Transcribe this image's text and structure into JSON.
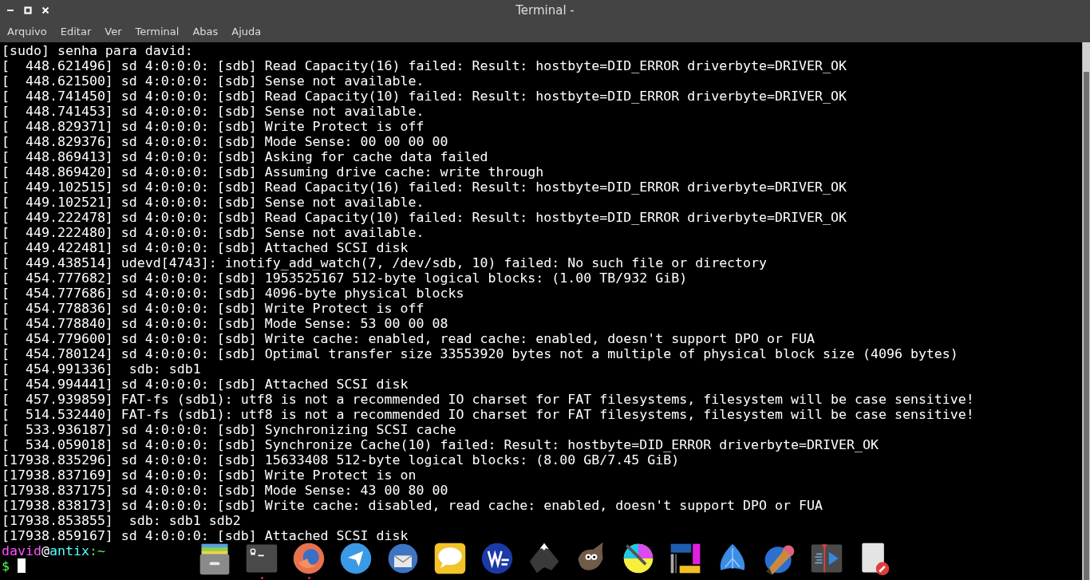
{
  "window": {
    "title": "Terminal -",
    "controls": [
      {
        "kind": "minimize"
      },
      {
        "kind": "maximize"
      },
      {
        "kind": "close"
      }
    ]
  },
  "menu": [
    "Arquivo",
    "Editar",
    "Ver",
    "Terminal",
    "Abas",
    "Ajuda"
  ],
  "lines": [
    "[sudo] senha para david:",
    "[  448.621496] sd 4:0:0:0: [sdb] Read Capacity(16) failed: Result: hostbyte=DID_ERROR driverbyte=DRIVER_OK",
    "[  448.621500] sd 4:0:0:0: [sdb] Sense not available.",
    "[  448.741450] sd 4:0:0:0: [sdb] Read Capacity(10) failed: Result: hostbyte=DID_ERROR driverbyte=DRIVER_OK",
    "[  448.741453] sd 4:0:0:0: [sdb] Sense not available.",
    "[  448.829371] sd 4:0:0:0: [sdb] Write Protect is off",
    "[  448.829376] sd 4:0:0:0: [sdb] Mode Sense: 00 00 00 00",
    "[  448.869413] sd 4:0:0:0: [sdb] Asking for cache data failed",
    "[  448.869420] sd 4:0:0:0: [sdb] Assuming drive cache: write through",
    "[  449.102515] sd 4:0:0:0: [sdb] Read Capacity(16) failed: Result: hostbyte=DID_ERROR driverbyte=DRIVER_OK",
    "[  449.102521] sd 4:0:0:0: [sdb] Sense not available.",
    "[  449.222478] sd 4:0:0:0: [sdb] Read Capacity(10) failed: Result: hostbyte=DID_ERROR driverbyte=DRIVER_OK",
    "[  449.222480] sd 4:0:0:0: [sdb] Sense not available.",
    "[  449.422481] sd 4:0:0:0: [sdb] Attached SCSI disk",
    "[  449.438514] udevd[4743]: inotify_add_watch(7, /dev/sdb, 10) failed: No such file or directory",
    "[  454.777682] sd 4:0:0:0: [sdb] 1953525167 512-byte logical blocks: (1.00 TB/932 GiB)",
    "[  454.777686] sd 4:0:0:0: [sdb] 4096-byte physical blocks",
    "[  454.778836] sd 4:0:0:0: [sdb] Write Protect is off",
    "[  454.778840] sd 4:0:0:0: [sdb] Mode Sense: 53 00 00 08",
    "[  454.779600] sd 4:0:0:0: [sdb] Write cache: enabled, read cache: enabled, doesn't support DPO or FUA",
    "[  454.780124] sd 4:0:0:0: [sdb] Optimal transfer size 33553920 bytes not a multiple of physical block size (4096 bytes)",
    "[  454.991336]  sdb: sdb1",
    "[  454.994441] sd 4:0:0:0: [sdb] Attached SCSI disk",
    "[  457.939859] FAT-fs (sdb1): utf8 is not a recommended IO charset for FAT filesystems, filesystem will be case sensitive!",
    "[  514.532440] FAT-fs (sdb1): utf8 is not a recommended IO charset for FAT filesystems, filesystem will be case sensitive!",
    "[  533.936187] sd 4:0:0:0: [sdb] Synchronizing SCSI cache",
    "[  534.059018] sd 4:0:0:0: [sdb] Synchronize Cache(10) failed: Result: hostbyte=DID_ERROR driverbyte=DRIVER_OK",
    "[17938.835296] sd 4:0:0:0: [sdb] 15633408 512-byte logical blocks: (8.00 GB/7.45 GiB)",
    "[17938.837169] sd 4:0:0:0: [sdb] Write Protect is on",
    "[17938.837175] sd 4:0:0:0: [sdb] Mode Sense: 43 00 80 00",
    "[17938.838173] sd 4:0:0:0: [sdb] Write cache: disabled, read cache: enabled, doesn't support DPO or FUA",
    "[17938.853855]  sdb: sdb1 sdb2",
    "[17938.859167] sd 4:0:0:0: [sdb] Attached SCSI disk"
  ],
  "prompt": {
    "parts": [
      {
        "text": "david",
        "color": "#ff55ff"
      },
      {
        "text": "@",
        "color": "#ffffff"
      },
      {
        "text": "antix",
        "color": "#55ffff"
      },
      {
        "text": ":~",
        "color": "#55ff55"
      }
    ],
    "symbol": "$"
  },
  "dock": [
    {
      "kind": "drawer",
      "running": false
    },
    {
      "kind": "terminal",
      "running": true
    },
    {
      "kind": "fox",
      "running": true
    },
    {
      "kind": "plane",
      "running": false
    },
    {
      "kind": "bird",
      "running": false
    },
    {
      "kind": "bubble",
      "running": false
    },
    {
      "kind": "logo",
      "running": false
    },
    {
      "kind": "mountain",
      "running": false
    },
    {
      "kind": "wilber",
      "running": false
    },
    {
      "kind": "brush",
      "running": false
    },
    {
      "kind": "layout",
      "running": false
    },
    {
      "kind": "fan",
      "running": false
    },
    {
      "kind": "pencil",
      "running": false
    },
    {
      "kind": "video",
      "running": false
    },
    {
      "kind": "doc",
      "running": false
    }
  ]
}
